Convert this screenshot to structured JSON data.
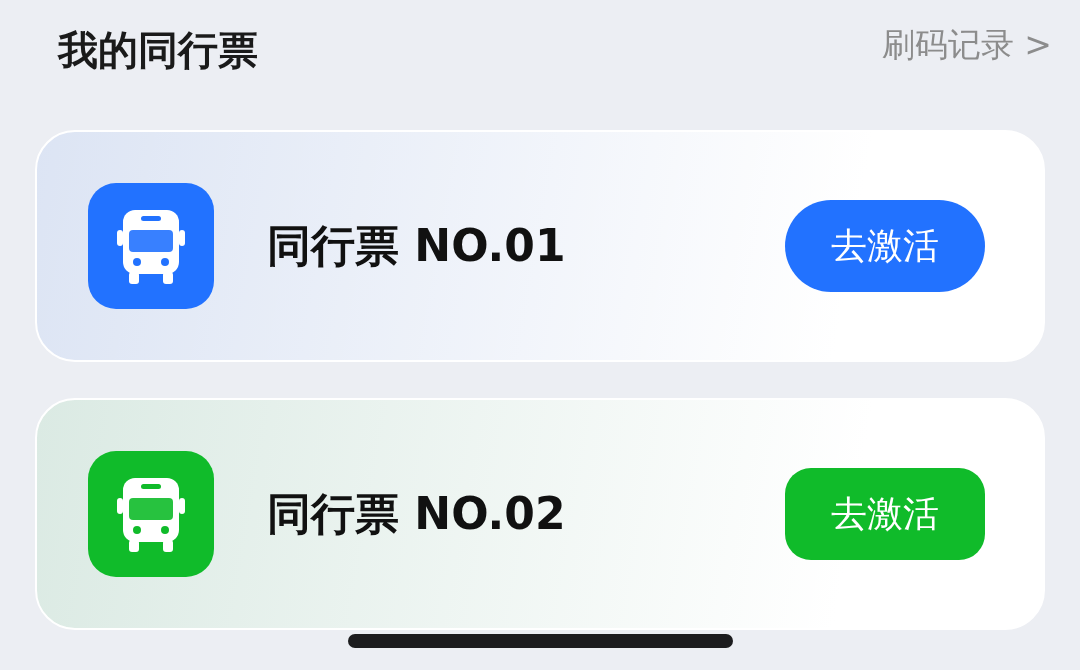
{
  "header": {
    "title": "我的同行票",
    "link": "刷码记录 >"
  },
  "tickets": [
    {
      "name": "同行票 NO.01",
      "button": "去激活",
      "color": "#2272ff",
      "kind": "pill"
    },
    {
      "name": "同行票 NO.02",
      "button": "去激活",
      "color": "#10bb2a",
      "kind": "rounded"
    }
  ]
}
